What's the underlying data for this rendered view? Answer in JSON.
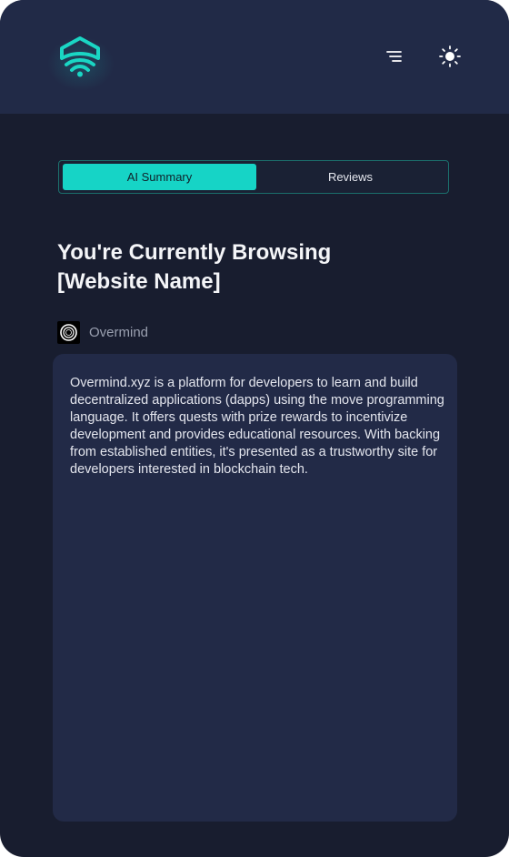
{
  "tabs": {
    "ai_summary": "AI Summary",
    "reviews": "Reviews",
    "active": "AI Summary"
  },
  "page": {
    "title_line1": "You're Currently Browsing",
    "title_line2": "[Website Name]"
  },
  "site": {
    "name": "Overmind",
    "icon": "overmind-logo-icon"
  },
  "summary": {
    "text": "Overmind.xyz is a platform for developers to learn and build decentralized applications (dapps) using the move programming language. It offers quests with prize rewards to incentivize development and provides educational resources. With backing from established entities, it's presented as a trustworthy site for developers interested in blockchain tech."
  },
  "icons": {
    "logo": "shield-wifi-logo-icon",
    "menu": "menu-icon",
    "theme": "sun-icon"
  },
  "colors": {
    "accent": "#16d4c6",
    "background": "#181d2f",
    "header": "#212a47",
    "card": "#222a47"
  }
}
